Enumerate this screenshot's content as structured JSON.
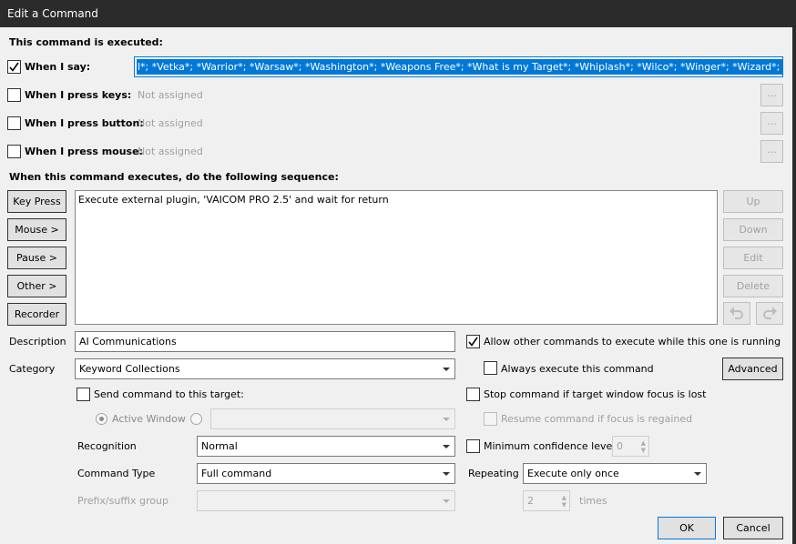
{
  "window": {
    "title": "Edit a Command"
  },
  "section_executed": "This command is executed:",
  "triggers": [
    {
      "label": "When I say:",
      "checked": true,
      "value": "l*; *Vetka*; *Warrior*; *Warsaw*; *Washington*; *Weapons Free*; *What is my Target*; *Whiplash*; *Wilco*; *Winger*; *Wizard*; *Yunga*"
    },
    {
      "label": "When I press keys:",
      "checked": false,
      "value": "Not assigned",
      "more": "..."
    },
    {
      "label": "When I press button:",
      "checked": false,
      "value": "Not assigned",
      "more": "..."
    },
    {
      "label": "When I press mouse:",
      "checked": false,
      "value": "Not assigned",
      "more": "..."
    }
  ],
  "section_sequence": "When this command executes, do the following sequence:",
  "left_buttons": [
    "Key Press",
    "Mouse >",
    "Pause >",
    "Other >",
    "Recorder"
  ],
  "sequence_items": [
    "Execute external plugin, 'VAICOM PRO 2.5' and wait for return"
  ],
  "right_buttons": [
    "Up",
    "Down",
    "Edit",
    "Delete"
  ],
  "undo_icon": "undo-arrow-icon",
  "redo_icon": "redo-arrow-icon",
  "description": {
    "label": "Description",
    "value": "AI Communications"
  },
  "category": {
    "label": "Category",
    "value": "Keyword Collections"
  },
  "allow_other": {
    "label": "Allow other commands to execute while this one is running",
    "checked": true
  },
  "always_execute": {
    "label": "Always execute this command",
    "checked": false
  },
  "advanced_button": "Advanced",
  "send_target": {
    "label": "Send command to this target:",
    "checked": false
  },
  "active_window": {
    "label": "Active Window"
  },
  "stop_command": {
    "label": "Stop command if target window focus is lost",
    "checked": false
  },
  "resume_command": {
    "label": "Resume command if focus is regained",
    "checked": false
  },
  "recognition": {
    "label": "Recognition",
    "value": "Normal"
  },
  "min_confidence": {
    "label": "Minimum confidence level",
    "checked": false,
    "value": "0"
  },
  "command_type": {
    "label": "Command Type",
    "value": "Full command"
  },
  "repeating": {
    "label": "Repeating",
    "value": "Execute only once",
    "count": "2",
    "times_label": "times"
  },
  "prefix_suffix": {
    "label": "Prefix/suffix group",
    "value": ""
  },
  "ok_button": "OK",
  "cancel_button": "Cancel",
  "colors": {
    "titlebar": "#2b2b2b",
    "selection": "#0078d7",
    "dialog_bg": "#f0f0f0"
  }
}
